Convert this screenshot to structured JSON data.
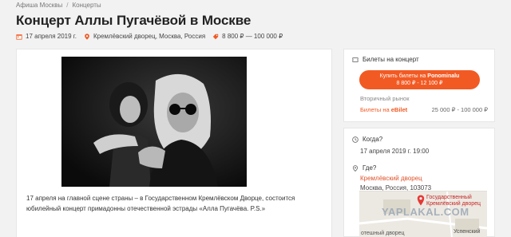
{
  "breadcrumb": [
    "Афиша Москвы",
    "/",
    "Концерты"
  ],
  "title": "Концерт Аллы Пугачёвой в Москве",
  "meta": {
    "date": "17 апреля 2019 г.",
    "venue": "Кремлёвский дворец, Москва, Россия",
    "price": "8 800 ₽ — 100 000 ₽"
  },
  "description": "17 апреля на главной сцене страны – в Государственном Кремлёвском Дворце, состоится юбилейный концерт примадонны отечественной эстрады «Алла Пугачёва. P.S.»",
  "tickets": {
    "header": "Билеты на концерт",
    "button_prefix": "Купить билеты на",
    "button_brand": "Ponominalu",
    "button_price": "8 800 ₽ - 12 100 ₽",
    "secondary_label": "Вторичный рынок",
    "eb_prefix": "Билеты на",
    "eb_brand": "eBilet",
    "eb_price": "25 000 ₽ - 100 000 ₽"
  },
  "when": {
    "label": "Когда?",
    "value": "17 апреля 2019 г. 19:00"
  },
  "where": {
    "label": "Где?",
    "venue": "Кремлёвский дворец",
    "address": "Москва, Россия, 103073"
  },
  "map": {
    "pin_label": "Государственный Кремлёвский дворец",
    "label_bottom_left": "отешный дворец",
    "label_bottom_right": "Успенский"
  },
  "watermark": "YAPLAKAL.COM",
  "colors": {
    "accent": "#f25a23",
    "background": "#f2f2f2",
    "card": "#ffffff"
  },
  "icons": [
    "calendar-icon",
    "location-pin-icon",
    "price-tag-icon",
    "ticket-icon",
    "clock-icon",
    "map-pin-icon"
  ]
}
